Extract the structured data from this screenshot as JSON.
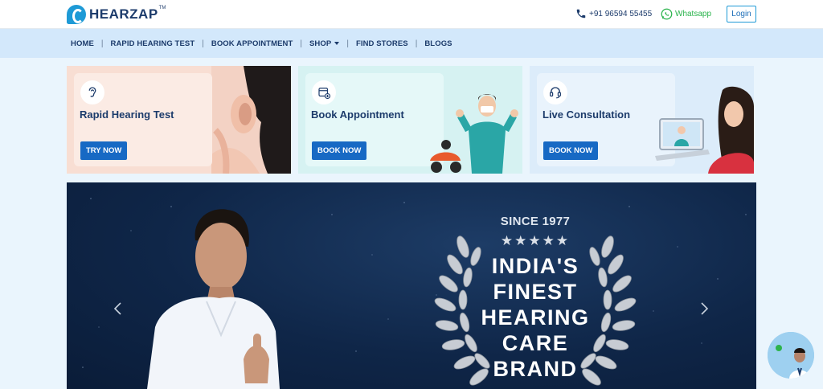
{
  "header": {
    "brand": "HEARZAP",
    "brand_tm": "TM",
    "phone": "+91 96594 55455",
    "whatsapp": "Whatsapp",
    "login": "Login"
  },
  "nav": {
    "items": [
      {
        "label": "HOME"
      },
      {
        "label": "RAPID HEARING TEST"
      },
      {
        "label": "BOOK APPOINTMENT"
      },
      {
        "label": "SHOP"
      },
      {
        "label": "FIND STORES"
      },
      {
        "label": "BLOGS"
      }
    ]
  },
  "cards": [
    {
      "title": "Rapid Hearing Test",
      "button": "TRY NOW",
      "icon": "ear-icon"
    },
    {
      "title": "Book Appointment",
      "button": "BOOK NOW",
      "icon": "calendar-icon"
    },
    {
      "title": "Live Consultation",
      "button": "BOOK NOW",
      "icon": "headset-icon"
    }
  ],
  "hero": {
    "since": "SINCE 1977",
    "stars": "★★★★★",
    "headline_lines": [
      "INDIA'S",
      "FINEST",
      "HEARING",
      "CARE",
      "BRAND"
    ]
  },
  "colors": {
    "brand_blue": "#1769c4",
    "navy_text": "#1c3b6b",
    "nav_bg": "#d3e8fb",
    "whatsapp_green": "#29b34b",
    "hero_bg": "#0f2648"
  }
}
